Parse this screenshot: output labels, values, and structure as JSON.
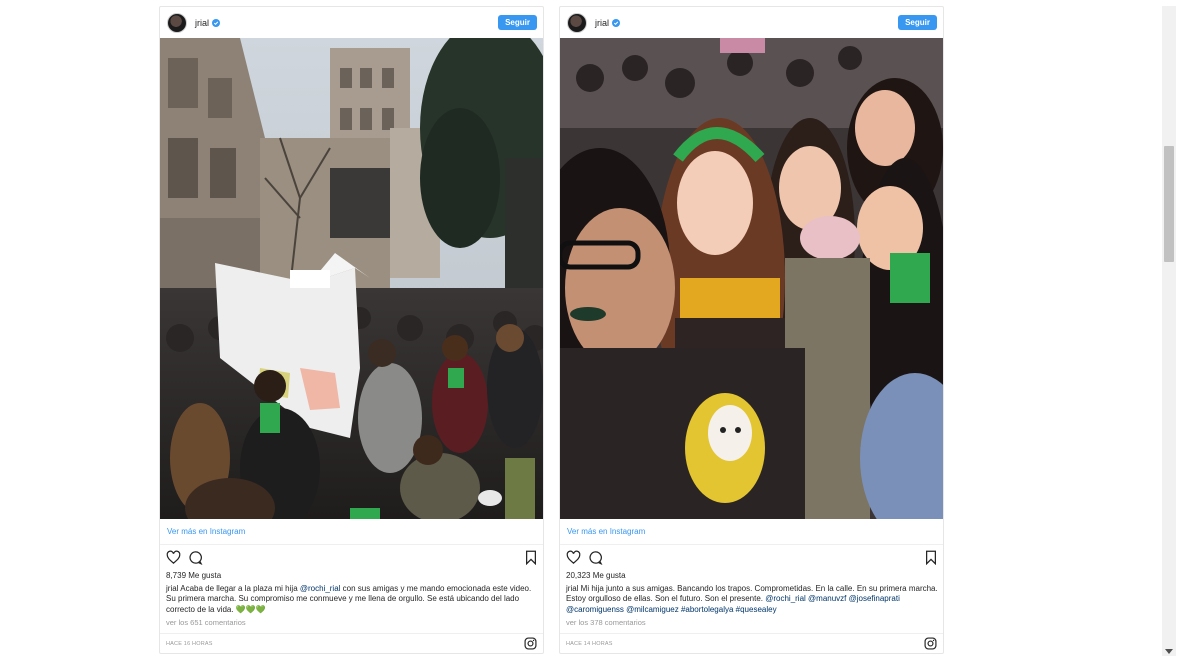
{
  "posts": [
    {
      "username": "jrial",
      "follow_label": "Seguir",
      "view_more": "Ver más en Instagram",
      "likes": "8,739 Me gusta",
      "caption_user": "jrial",
      "caption_text": " Acaba de llegar a la plaza mi hija ",
      "caption_mention": "@rochi_rial",
      "caption_rest": " con sus amigas y me mando emocionada este video. Su primera marcha. Su compromiso me conmueve y me llena de orgullo. Se está ubicando del lado correcto de la vida. 💚💚💚",
      "comments": "ver los 651 comentarios",
      "time": "HACE 16 HORAS",
      "photo_icon": "street-march-photo"
    },
    {
      "username": "jrial",
      "follow_label": "Seguir",
      "view_more": "Ver más en Instagram",
      "likes": "20,323 Me gusta",
      "caption_user": "jrial",
      "caption_text": " Mi hija junto a sus amigas. Bancando los trapos. Comprometidas. En la calle. En su primera marcha. Estoy orgulloso de ellas. Son el futuro. Son el presente. ",
      "caption_mention": "@rochi_rial @manuvzf @josefinaprati @caromiguenss @milcamiguez #abortolegalya #quesealey",
      "caption_rest": "",
      "comments": "ver los 378 comentarios",
      "time": "HACE 14 HORAS",
      "photo_icon": "group-selfie-photo"
    }
  ],
  "icons": {
    "like": "heart-icon",
    "comment": "comment-icon",
    "save": "bookmark-icon",
    "logo": "instagram-icon",
    "verified": "verified-badge-icon"
  },
  "colors": {
    "accent": "#3897f0",
    "mention": "#003569",
    "muted": "#999999",
    "green_scarf": "#2fa84f"
  }
}
